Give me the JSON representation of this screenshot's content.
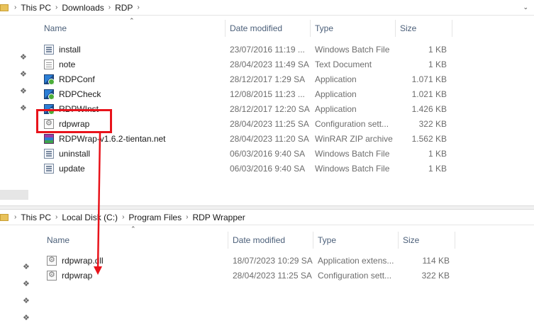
{
  "top": {
    "breadcrumb": [
      "This PC",
      "Downloads",
      "RDP"
    ],
    "columns": {
      "name": "Name",
      "date": "Date modified",
      "type": "Type",
      "size": "Size"
    },
    "files": [
      {
        "name": "install",
        "date": "23/07/2016 11:19 ...",
        "type": "Windows Batch File",
        "size": "1 KB",
        "icon": "batch-file-icon"
      },
      {
        "name": "note",
        "date": "28/04/2023 11:49 SA",
        "type": "Text Document",
        "size": "1 KB",
        "icon": "text-document-icon"
      },
      {
        "name": "RDPConf",
        "date": "28/12/2017 1:29 SA",
        "type": "Application",
        "size": "1.071 KB",
        "icon": "application-icon"
      },
      {
        "name": "RDPCheck",
        "date": "12/08/2015 11:23 ...",
        "type": "Application",
        "size": "1.021 KB",
        "icon": "application-icon"
      },
      {
        "name": "RDPWInst",
        "date": "28/12/2017 12:20 SA",
        "type": "Application",
        "size": "1.426 KB",
        "icon": "application-icon"
      },
      {
        "name": "rdpwrap",
        "date": "28/04/2023 11:25 SA",
        "type": "Configuration sett...",
        "size": "322 KB",
        "icon": "config-file-icon"
      },
      {
        "name": "RDPWrap-v1.6.2-tientan.net",
        "date": "28/04/2023 11:20 SA",
        "type": "WinRAR ZIP archive",
        "size": "1.562 KB",
        "icon": "zip-archive-icon"
      },
      {
        "name": "uninstall",
        "date": "06/03/2016 9:40 SA",
        "type": "Windows Batch File",
        "size": "1 KB",
        "icon": "batch-file-icon"
      },
      {
        "name": "update",
        "date": "06/03/2016 9:40 SA",
        "type": "Windows Batch File",
        "size": "1 KB",
        "icon": "batch-file-icon"
      }
    ]
  },
  "bottom": {
    "breadcrumb": [
      "This PC",
      "Local Disk (C:)",
      "Program Files",
      "RDP Wrapper"
    ],
    "columns": {
      "name": "Name",
      "date": "Date modified",
      "type": "Type",
      "size": "Size"
    },
    "files": [
      {
        "name": "rdpwrap.dll",
        "date": "18/07/2023 10:29 SA",
        "type": "Application extens...",
        "size": "114 KB",
        "icon": "dll-file-icon"
      },
      {
        "name": "rdpwrap",
        "date": "28/04/2023 11:25 SA",
        "type": "Configuration sett...",
        "size": "322 KB",
        "icon": "config-file-icon"
      }
    ]
  },
  "annotation": {
    "color": "#e8131b",
    "highlighted_file": "rdpwrap"
  }
}
